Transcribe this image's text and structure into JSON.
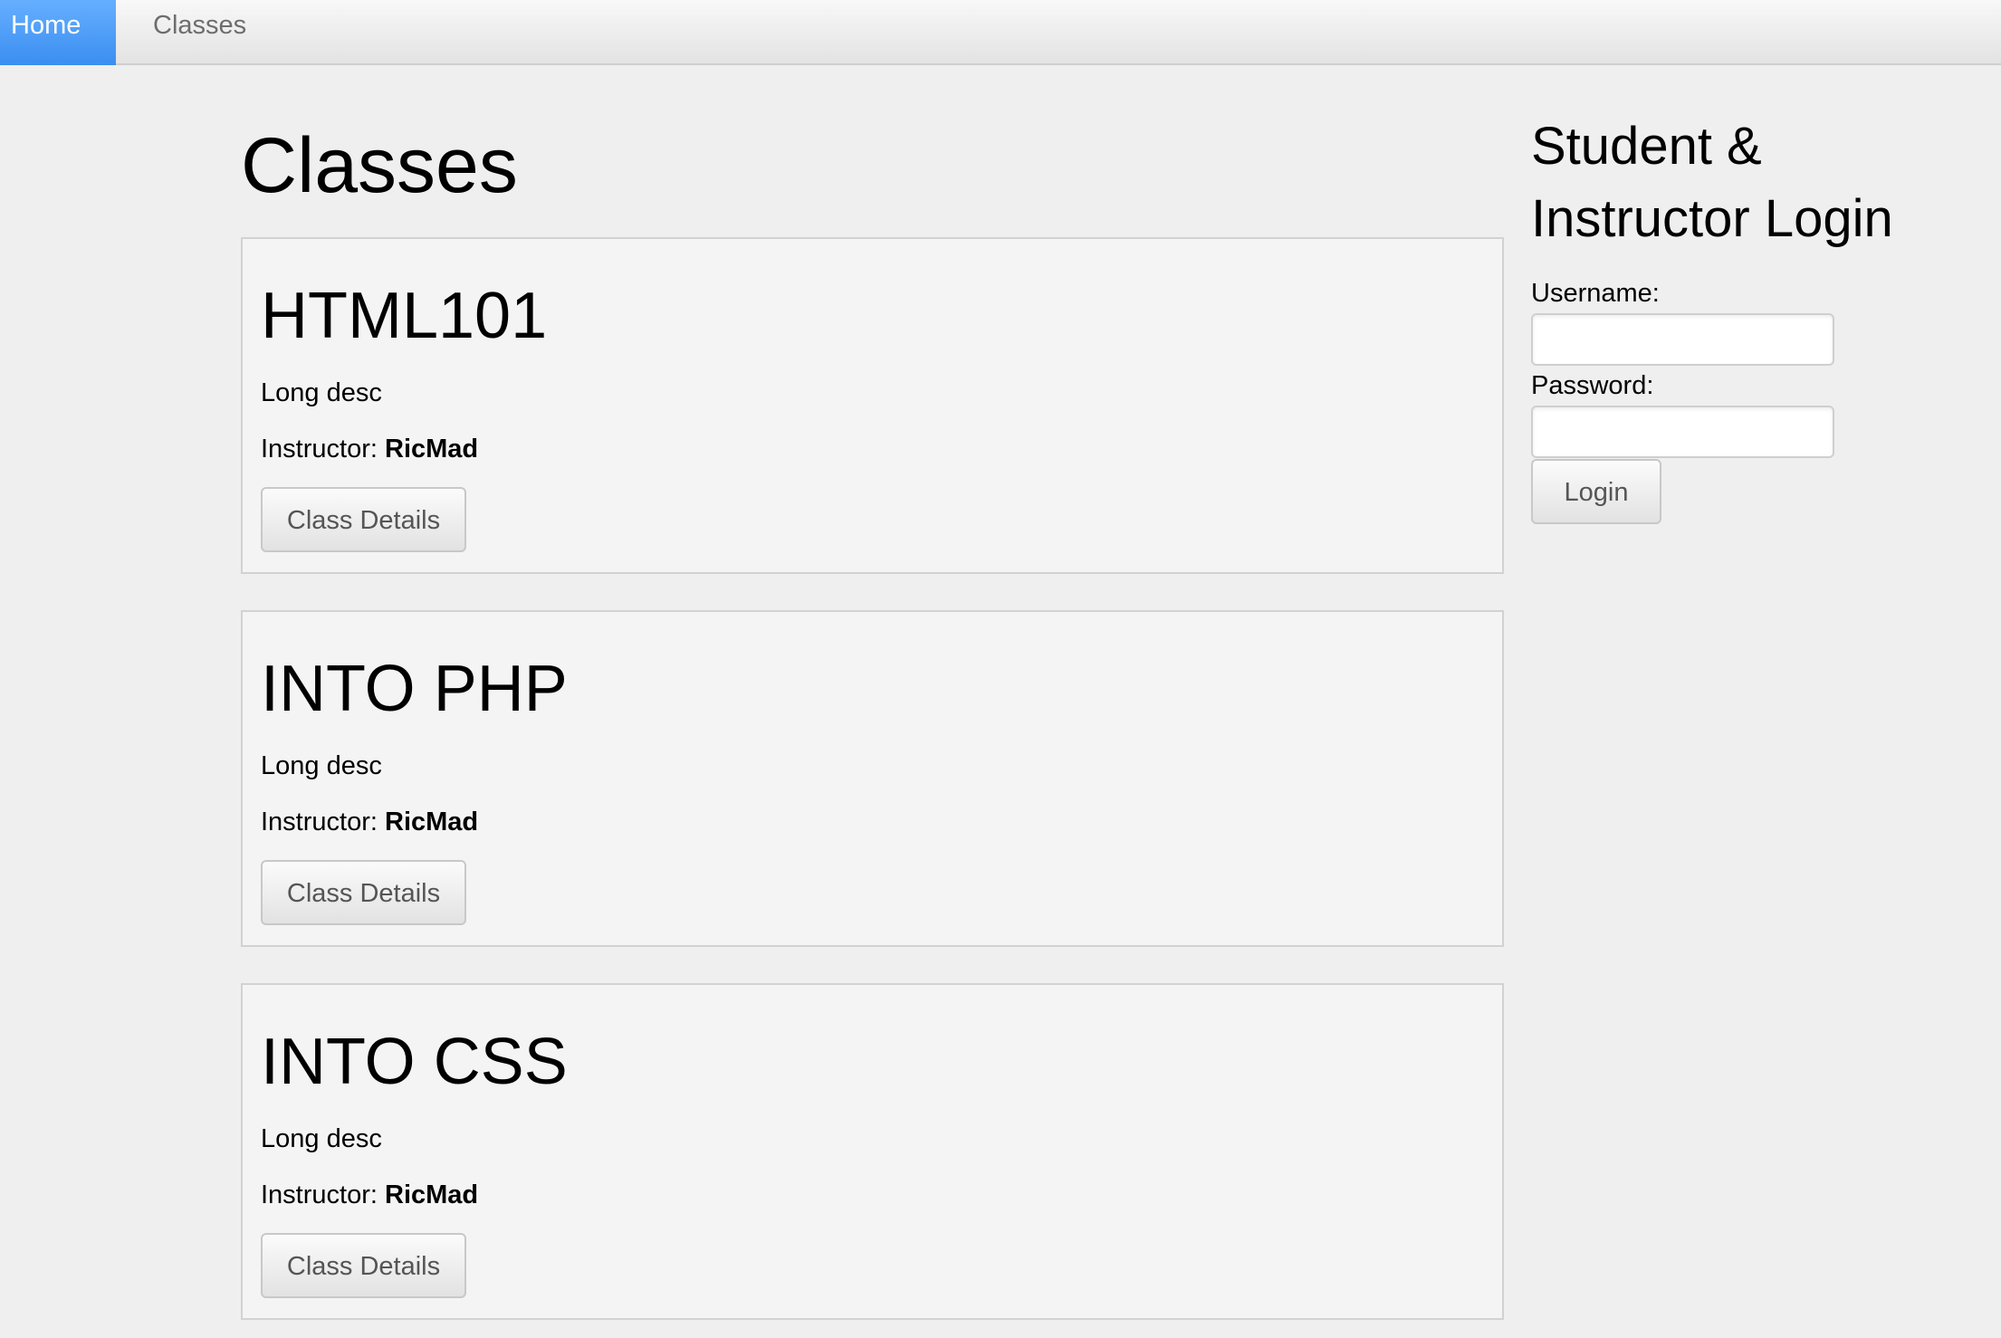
{
  "nav": {
    "items": [
      {
        "label": "Home",
        "active": true
      },
      {
        "label": "Classes",
        "active": false
      }
    ]
  },
  "main": {
    "title": "Classes",
    "classes": [
      {
        "name": "HTML101",
        "description": "Long desc",
        "instructor_label": "Instructor:",
        "instructor": "RicMad",
        "button_label": "Class Details"
      },
      {
        "name": "INTO PHP",
        "description": "Long desc",
        "instructor_label": "Instructor:",
        "instructor": "RicMad",
        "button_label": "Class Details"
      },
      {
        "name": "INTO CSS",
        "description": "Long desc",
        "instructor_label": "Instructor:",
        "instructor": "RicMad",
        "button_label": "Class Details"
      }
    ]
  },
  "login": {
    "title": "Student & Instructor Login",
    "username_label": "Username:",
    "username_value": "",
    "password_label": "Password:",
    "password_value": "",
    "button_label": "Login"
  },
  "colors": {
    "nav_active": "#3a8ef0",
    "background": "#efefef",
    "card_background": "#f4f4f4"
  }
}
